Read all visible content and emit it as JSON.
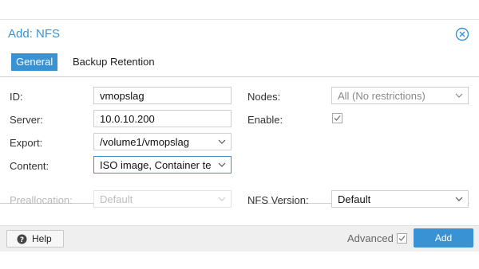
{
  "dialog": {
    "title": "Add: NFS",
    "tabs": [
      {
        "label": "General",
        "active": true
      },
      {
        "label": "Backup Retention",
        "active": false
      }
    ]
  },
  "form": {
    "id": {
      "label": "ID:",
      "value": "vmopslag"
    },
    "server": {
      "label": "Server:",
      "value": "10.0.10.200"
    },
    "export": {
      "label": "Export:",
      "value": "/volume1/vmopslag"
    },
    "content": {
      "label": "Content:",
      "value": "ISO image, Container te"
    },
    "nodes": {
      "label": "Nodes:",
      "value": "All (No restrictions)"
    },
    "enable": {
      "label": "Enable:",
      "checked": true
    },
    "preallocation": {
      "label": "Preallocation:",
      "value": "Default",
      "disabled": true
    },
    "nfs_version": {
      "label": "NFS Version:",
      "value": "Default"
    }
  },
  "footer": {
    "help_label": "Help",
    "advanced_label": "Advanced",
    "advanced_checked": true,
    "add_label": "Add"
  },
  "colors": {
    "accent": "#3892d4"
  },
  "icons": {
    "close": "close-circle-icon",
    "help": "question-circle-icon",
    "dropdown": "chevron-down-icon",
    "checkbox": "checkmark-icon"
  }
}
